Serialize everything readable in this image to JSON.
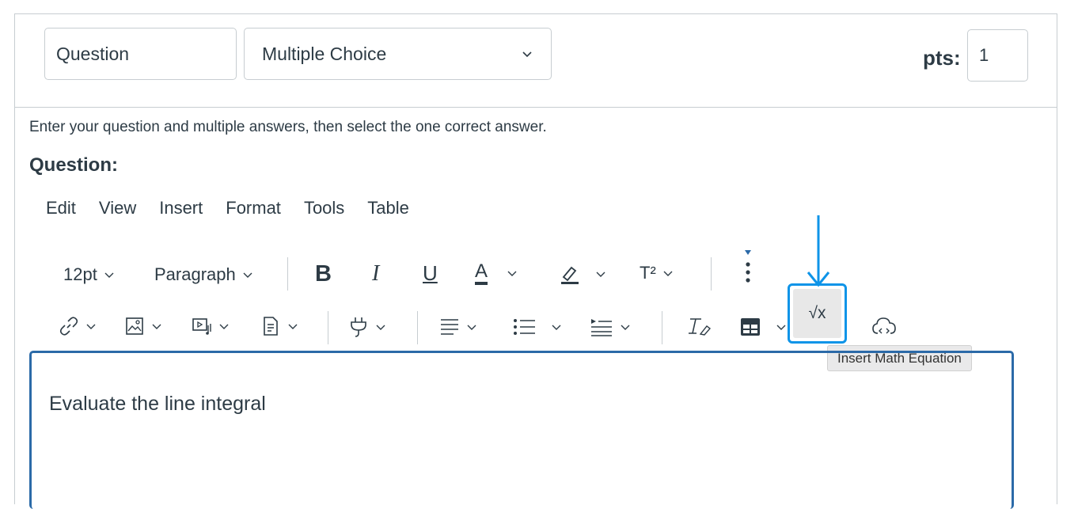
{
  "question": {
    "name_value": "Question",
    "type_value": "Multiple Choice",
    "points_label": "pts:",
    "points_value": "1"
  },
  "instruction": "Enter your question and multiple answers, then select the one correct answer.",
  "question_label": "Question:",
  "menubar": [
    "Edit",
    "View",
    "Insert",
    "Format",
    "Tools",
    "Table"
  ],
  "toolbar": {
    "font_size": "12pt",
    "block_format": "Paragraph",
    "bold": "B",
    "italic": "I",
    "underline": "U",
    "text_color": "A",
    "superscript": "T²",
    "math_label": "√x",
    "math_tooltip": "Insert Math Equation"
  },
  "editor": {
    "content": "Evaluate the line integral"
  },
  "colors": {
    "highlight": "#0e94e8",
    "editor_border": "#2b6aa8",
    "text": "#2d3b45"
  },
  "icons": [
    "chevron-down-icon",
    "link-icon",
    "image-icon",
    "media-icon",
    "document-icon",
    "plug-icon",
    "align-icon",
    "list-icon",
    "indent-icon",
    "clear-format-icon",
    "table-icon",
    "cloud-embed-icon",
    "more-icon",
    "down-arrow-icon"
  ]
}
